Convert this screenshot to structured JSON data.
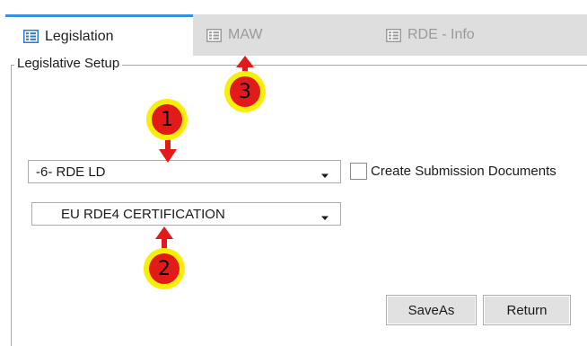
{
  "tabs": [
    {
      "label": "Legislation",
      "icon": "form-list-icon",
      "active": true
    },
    {
      "label": "MAW",
      "icon": "form-list-icon",
      "active": false
    },
    {
      "label": "RDE - Info",
      "icon": "form-list-icon",
      "active": false
    }
  ],
  "group": {
    "title": "Legislative Setup"
  },
  "legislation_combo": {
    "value": "-6- RDE LD"
  },
  "certification_combo": {
    "value": "EU RDE4 CERTIFICATION"
  },
  "create_docs": {
    "label": "Create Submission Documents",
    "checked": false
  },
  "buttons": {
    "save_as": "SaveAs",
    "return": "Return"
  },
  "annotations": [
    {
      "number": "1"
    },
    {
      "number": "2"
    },
    {
      "number": "3"
    }
  ],
  "colors": {
    "tab_accent": "#3b8fd6",
    "tab_strip": "#dedede",
    "callout_ring": "#f7ee0a",
    "callout_fill": "#e31a1a",
    "arrow": "#e31a1a"
  }
}
